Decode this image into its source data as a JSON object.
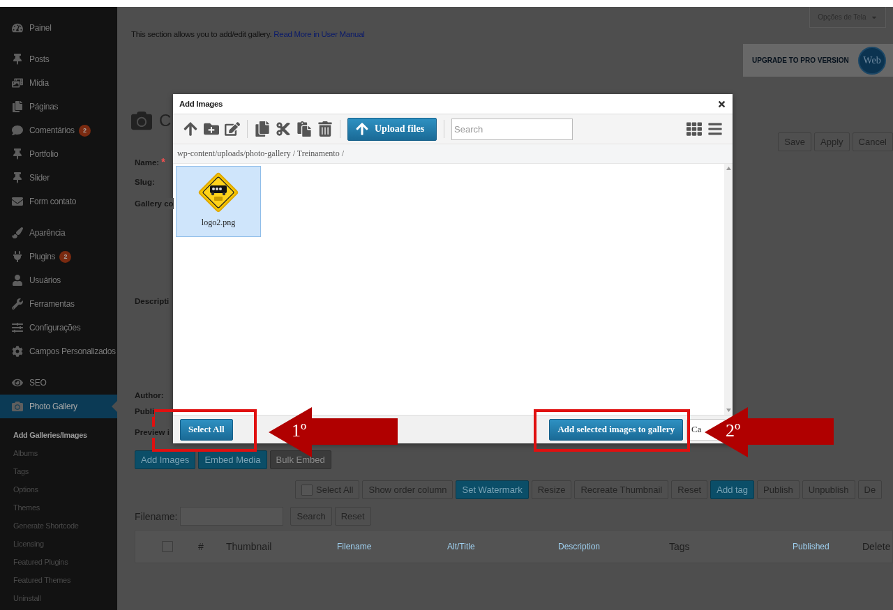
{
  "sidebar": {
    "groups": [
      {
        "items": [
          {
            "label": "Painel",
            "selected": false
          }
        ]
      },
      {
        "items": [
          {
            "label": "Posts",
            "selected": false
          },
          {
            "label": "Mídia",
            "selected": false
          },
          {
            "label": "Páginas",
            "selected": false
          },
          {
            "label": "Comentários",
            "badge": "2",
            "selected": false
          },
          {
            "label": "Portfolio",
            "selected": false
          },
          {
            "label": "Slider",
            "selected": false
          },
          {
            "label": "Form contato",
            "selected": false
          }
        ]
      },
      {
        "items": [
          {
            "label": "Aparência",
            "selected": false
          },
          {
            "label": "Plugins",
            "badge": "2",
            "selected": false
          },
          {
            "label": "Usuários",
            "selected": false
          },
          {
            "label": "Ferramentas",
            "selected": false
          },
          {
            "label": "Configurações",
            "selected": false
          },
          {
            "label": "Campos Personalizados",
            "selected": false
          }
        ]
      },
      {
        "items": [
          {
            "label": "SEO",
            "selected": false
          },
          {
            "label": "Photo Gallery",
            "selected": true
          }
        ]
      }
    ],
    "submenu": [
      {
        "label": "Add Galleries/Images",
        "selected": true
      },
      {
        "label": "Albums",
        "selected": false
      },
      {
        "label": "Tags",
        "selected": false
      },
      {
        "label": "Options",
        "selected": false
      },
      {
        "label": "Themes",
        "selected": false
      },
      {
        "label": "Generate Shortcode",
        "selected": false
      },
      {
        "label": "Licensing",
        "selected": false
      },
      {
        "label": "Featured Plugins",
        "selected": false
      },
      {
        "label": "Featured Themes",
        "selected": false
      },
      {
        "label": "Uninstall",
        "selected": false
      }
    ]
  },
  "screen_options": "Opções de Tela",
  "intro": {
    "text": "This section allows you to add/edit gallery.",
    "link": "Read More in User Manual"
  },
  "upgrade": {
    "text": "UPGRADE TO PRO VERSION",
    "logo": "Web"
  },
  "title": "C",
  "header_buttons": [
    "Save",
    "Apply",
    "Cancel"
  ],
  "form_labels": [
    {
      "text": "Name:",
      "required_mark": "*"
    },
    {
      "text": "Slug:"
    },
    {
      "text": "Gallery co"
    },
    {
      "text": "Descripti"
    },
    {
      "text": "Author:"
    },
    {
      "text": "Publi"
    },
    {
      "text": "Preview i"
    }
  ],
  "media_buttons": [
    {
      "label": "Add Images",
      "kind": "primary"
    },
    {
      "label": "Embed Media",
      "kind": "primary"
    },
    {
      "label": "Bulk Embed",
      "kind": "dark"
    }
  ],
  "actions": [
    {
      "label": "Select All",
      "kind": "checkbox",
      "checked": false
    },
    {
      "label": "Show order column",
      "kind": "default"
    },
    {
      "label": "Set Watermark",
      "kind": "primary"
    },
    {
      "label": "Resize",
      "kind": "default"
    },
    {
      "label": "Recreate Thumbnail",
      "kind": "default"
    },
    {
      "label": "Reset",
      "kind": "default"
    },
    {
      "label": "Add tag",
      "kind": "primary"
    },
    {
      "label": "Publish",
      "kind": "default"
    },
    {
      "label": "Unpublish",
      "kind": "default"
    },
    {
      "label": "De",
      "kind": "default"
    }
  ],
  "filter": {
    "label": "Filename:",
    "buttons": [
      "Search",
      "Reset"
    ]
  },
  "table": {
    "columns": [
      {
        "kind": "checkbox",
        "checked": false
      },
      {
        "label": "#",
        "kind": "plain"
      },
      {
        "label": "Thumbnail",
        "kind": "plain"
      },
      {
        "label": "Filename",
        "kind": "sortable"
      },
      {
        "label": "Alt/Title",
        "kind": "sortable"
      },
      {
        "label": "Description",
        "kind": "sortable"
      },
      {
        "label": "Tags",
        "kind": "plain"
      },
      {
        "label": "Published",
        "kind": "sortable"
      },
      {
        "label": "Delete",
        "kind": "plain"
      }
    ]
  },
  "dialog": {
    "title": "Add Images",
    "upload": "Upload files",
    "search_placeholder": "Search",
    "path": "wp-content/uploads/photo-gallery / Treinamento /",
    "files": [
      {
        "name": "logo2.png",
        "kind": "picture",
        "selected": true
      }
    ],
    "select_all": "Select All",
    "add": "Add selected images to gallery",
    "cancel": "Ca"
  },
  "annotations": [
    {
      "label": "1º"
    },
    {
      "label": "2º"
    }
  ]
}
